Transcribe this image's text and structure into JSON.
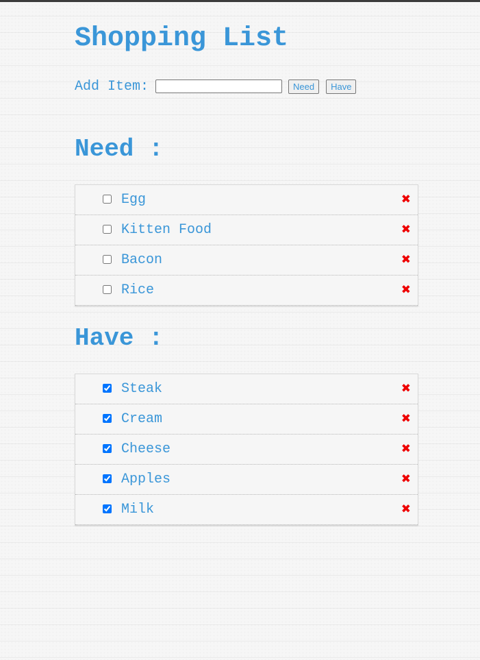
{
  "page": {
    "title": "Shopping List"
  },
  "add_form": {
    "label": "Add Item:",
    "input_value": "",
    "input_placeholder": "",
    "need_button": "Need",
    "have_button": "Have"
  },
  "need": {
    "heading": "Need :",
    "items": [
      {
        "label": "Egg",
        "checked": false
      },
      {
        "label": "Kitten Food",
        "checked": false
      },
      {
        "label": "Bacon",
        "checked": false
      },
      {
        "label": "Rice",
        "checked": false
      }
    ]
  },
  "have": {
    "heading": "Have :",
    "items": [
      {
        "label": "Steak",
        "checked": true
      },
      {
        "label": "Cream",
        "checked": true
      },
      {
        "label": "Cheese",
        "checked": true
      },
      {
        "label": "Apples",
        "checked": true
      },
      {
        "label": "Milk",
        "checked": true
      }
    ]
  },
  "icons": {
    "delete": "close-icon",
    "delete_glyph": "✖"
  },
  "colors": {
    "accent": "#3a96d8",
    "delete": "#ee0000",
    "top_bar": "#3c3c3c"
  }
}
